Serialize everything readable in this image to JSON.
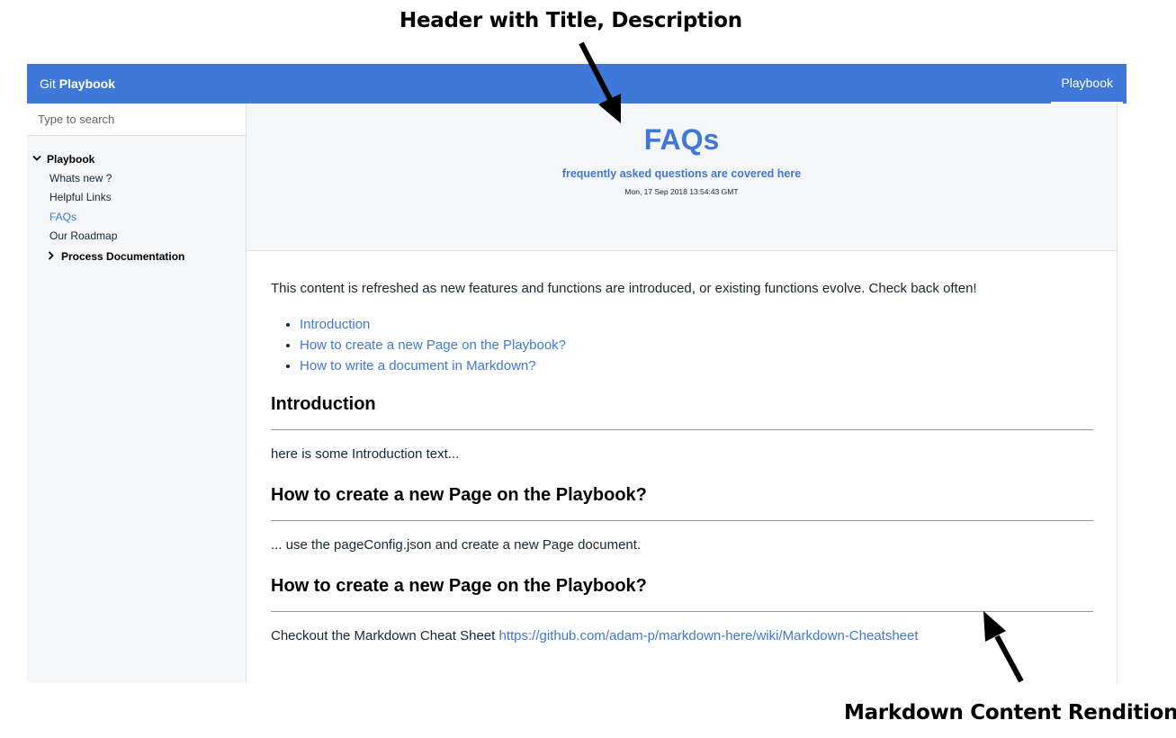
{
  "annotations": {
    "header_callout": "Header with Title, Description",
    "content_callout": "Markdown Content Rendition"
  },
  "topbar": {
    "brand_prefix": "Git",
    "brand_name": "Playbook",
    "nav_item": "Playbook",
    "color": "#3f78d9"
  },
  "sidebar": {
    "search_placeholder": "Type to search",
    "group_label": "Playbook",
    "items": [
      {
        "label": "Whats new ?"
      },
      {
        "label": "Helpful Links"
      },
      {
        "label": "FAQs"
      },
      {
        "label": "Our Roadmap"
      }
    ],
    "active_item": "FAQs",
    "subgroup_label": "Process Documentation"
  },
  "hero": {
    "title": "FAQs",
    "description": "frequently asked questions are covered here",
    "date": "Mon, 17 Sep 2018 13:54:43 GMT"
  },
  "content": {
    "intro": "This content is refreshed as new features and functions are introduced, or existing functions evolve. Check back often!",
    "toc": [
      "Introduction",
      "How to create a new Page on the Playbook?",
      "How to write a document in Markdown?"
    ],
    "sections": [
      {
        "heading": "Introduction",
        "body": "here is some Introduction text..."
      },
      {
        "heading": "How to create a new Page on the Playbook?",
        "body": "... use the pageConfig.json and create a new Page document."
      },
      {
        "heading": "How to create a new Page on the Playbook?",
        "body_prefix": "Checkout the Markdown Cheat Sheet",
        "link": "https://github.com/adam-p/markdown-here/wiki/Markdown-Cheatsheet"
      }
    ]
  }
}
